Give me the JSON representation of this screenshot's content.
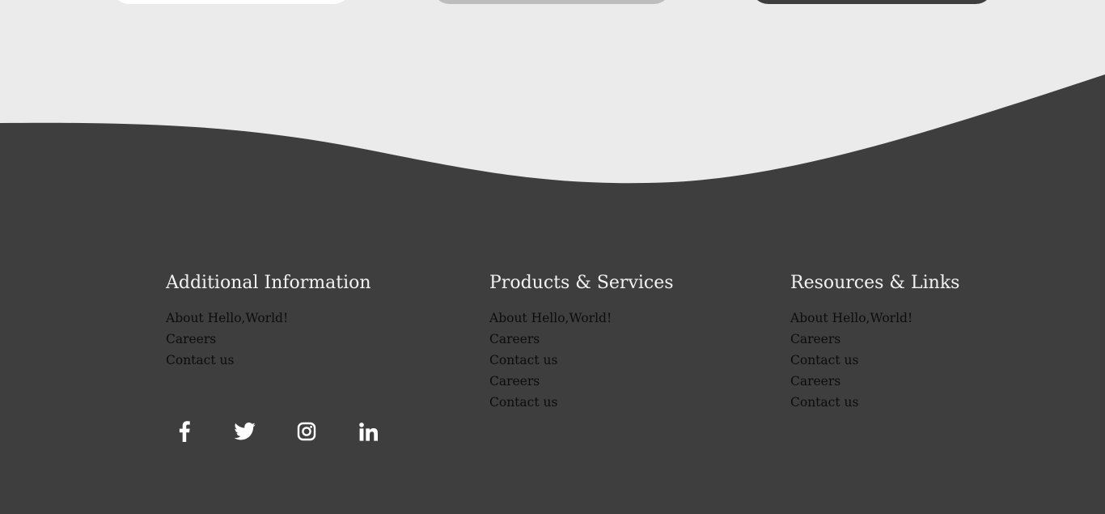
{
  "colors": {
    "page_background": "#ebebeb",
    "footer_background": "#3e3e3e",
    "heading_text": "#f2f2f2",
    "link_text": "#0c0c0c",
    "icon_color": "#ffffff",
    "card_white": "#ffffff",
    "card_gray": "#bdbdbd",
    "card_dark": "#3e3e3e"
  },
  "footer": {
    "columns": [
      {
        "heading": "Additional Information",
        "links": [
          "About Hello,World!",
          "Careers",
          "Contact us"
        ]
      },
      {
        "heading": "Products & Services",
        "links": [
          "About Hello,World!",
          "Careers",
          "Contact us",
          "Careers",
          "Contact us"
        ]
      },
      {
        "heading": "Resources & Links",
        "links": [
          "About Hello,World!",
          "Careers",
          "Contact us",
          "Careers",
          "Contact us"
        ]
      }
    ],
    "social_icons": [
      "facebook-icon",
      "twitter-icon",
      "instagram-icon",
      "linkedin-icon"
    ]
  }
}
